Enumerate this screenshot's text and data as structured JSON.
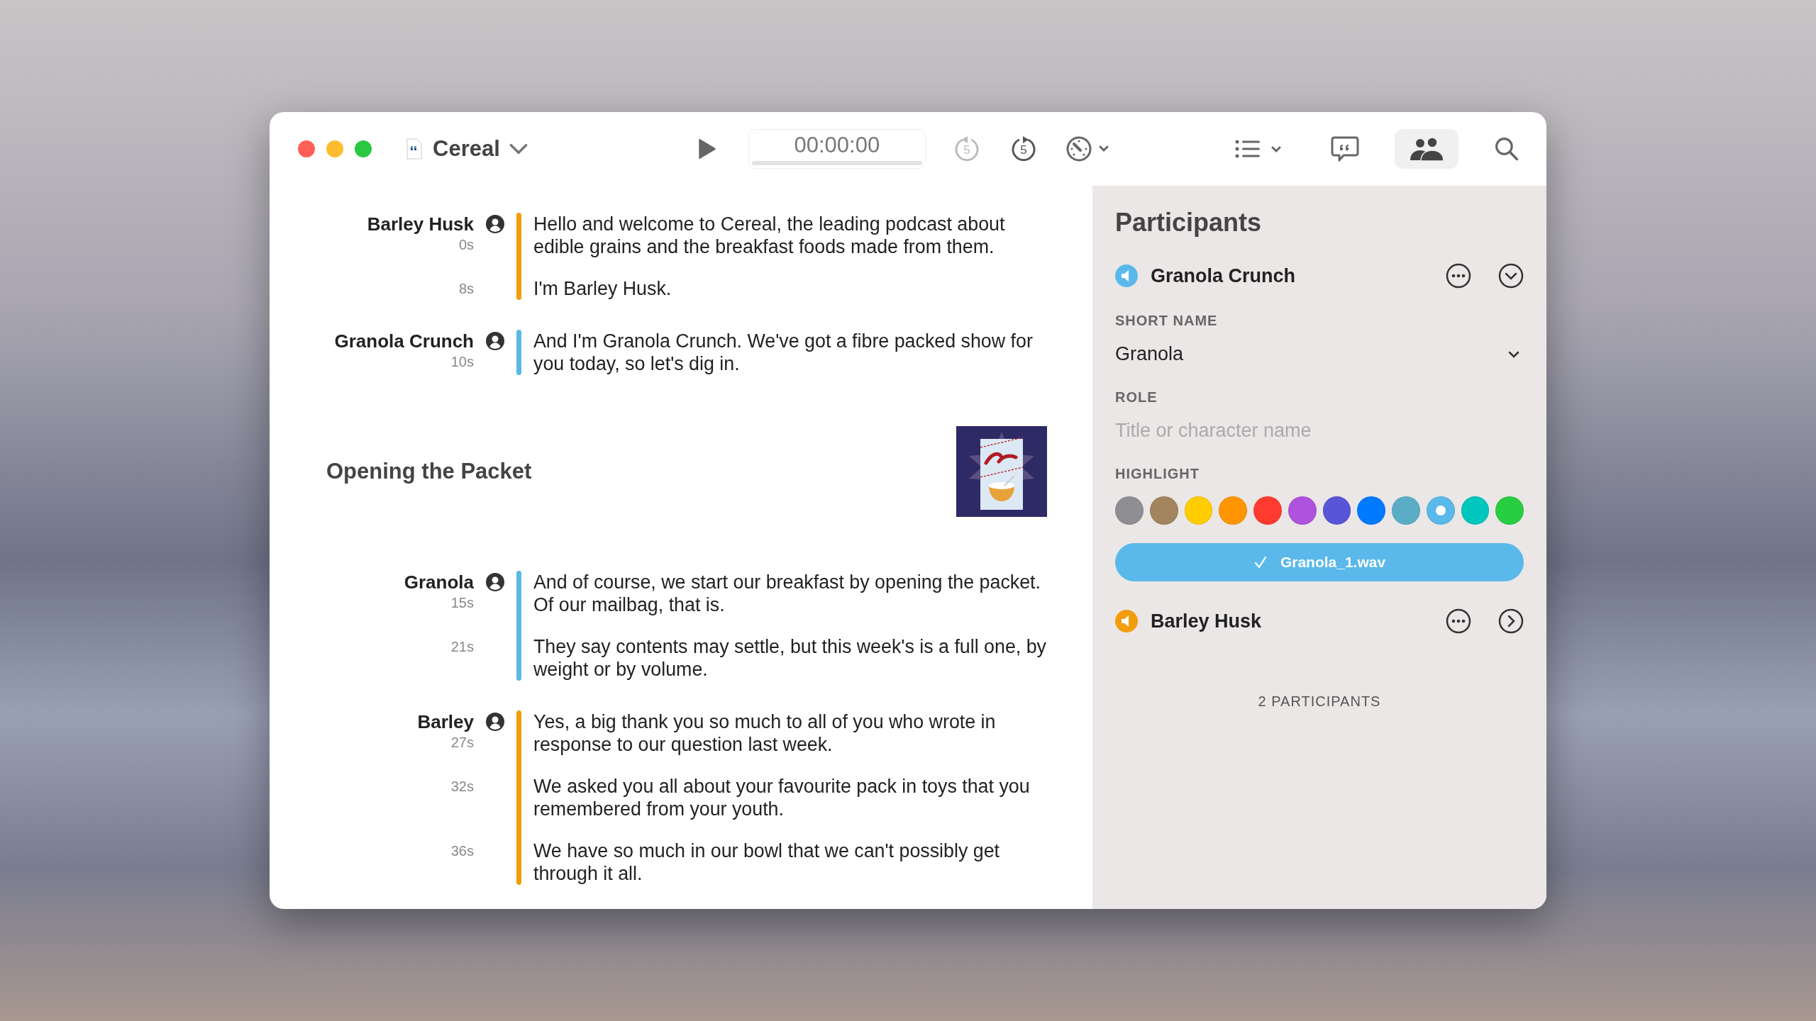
{
  "window": {
    "title": "Cereal"
  },
  "toolbar": {
    "timecode": "00:00:00",
    "skip_back": {
      "label": "5",
      "disabled": true
    },
    "skip_forward": {
      "label": "5",
      "disabled": false
    },
    "participants_toggle": {
      "selected": true
    }
  },
  "transcript": [
    {
      "kind": "speaker",
      "speaker": "Barley Husk",
      "color": "#f29d0c",
      "paragraphs": [
        {
          "time": "0s",
          "text": "Hello and welcome to Cereal, the leading podcast about edible grains and the breakfast foods made from them."
        },
        {
          "time": "8s",
          "text": "I'm Barley Husk."
        }
      ]
    },
    {
      "kind": "speaker",
      "speaker": "Granola Crunch",
      "color": "#5ab9ea",
      "paragraphs": [
        {
          "time": "10s",
          "text": "And I'm Granola Crunch. We've got a fibre packed show for you today, so let's dig in."
        }
      ]
    },
    {
      "kind": "chapter",
      "title": "Opening the Packet"
    },
    {
      "kind": "speaker",
      "speaker": "Granola",
      "color": "#5ab9ea",
      "paragraphs": [
        {
          "time": "15s",
          "text": "And of course, we start our breakfast by opening the packet. Of our mailbag, that is."
        },
        {
          "time": "21s",
          "text": "They say contents may settle, but this week's is a full one, by weight or by volume."
        }
      ]
    },
    {
      "kind": "speaker",
      "speaker": "Barley",
      "color": "#f29d0c",
      "paragraphs": [
        {
          "time": "27s",
          "text": "Yes, a big thank you so much to all of you who wrote in response to our question last week."
        },
        {
          "time": "32s",
          "text": "We asked you all about your favourite pack in toys that you remembered from your youth."
        },
        {
          "time": "36s",
          "text": "We have so much in our bowl that we can't possibly get through it all."
        }
      ]
    }
  ],
  "sidebar": {
    "title": "Participants",
    "short_name_label": "SHORT NAME",
    "role_label": "ROLE",
    "highlight_label": "HIGHLIGHT",
    "count": "2 PARTICIPANTS",
    "participants": [
      {
        "name": "Granola Crunch",
        "color": "#5ab9ea",
        "expanded": true,
        "short_name": "Granola",
        "role_placeholder": "Title or character name",
        "audio_file": "Granola_1.wav",
        "highlight_colors": [
          {
            "color": "#8e8e93",
            "selected": false
          },
          {
            "color": "#a2845e",
            "selected": false
          },
          {
            "color": "#ffcc00",
            "selected": false
          },
          {
            "color": "#ff9500",
            "selected": false
          },
          {
            "color": "#ff3b30",
            "selected": false
          },
          {
            "color": "#af52de",
            "selected": false
          },
          {
            "color": "#5856d6",
            "selected": false
          },
          {
            "color": "#007aff",
            "selected": false
          },
          {
            "color": "#5aadc5",
            "selected": false
          },
          {
            "color": "#5ab9ea",
            "selected": true
          },
          {
            "color": "#00c7be",
            "selected": false
          },
          {
            "color": "#28cd41",
            "selected": false
          }
        ]
      },
      {
        "name": "Barley Husk",
        "color": "#f29d0c",
        "expanded": false
      }
    ]
  }
}
